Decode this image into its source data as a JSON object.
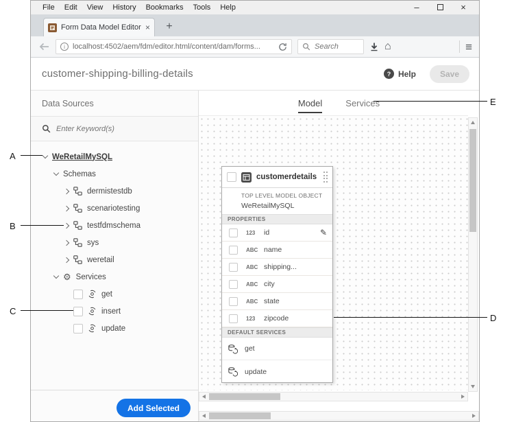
{
  "chrome": {
    "menu": [
      "File",
      "Edit",
      "View",
      "History",
      "Bookmarks",
      "Tools",
      "Help"
    ],
    "window_controls": {
      "minimize": "–",
      "close": "×"
    },
    "tab": {
      "title": "Form Data Model Editor",
      "close": "×",
      "new_tab": "+"
    },
    "urlbar": {
      "url": "localhost:4502/aem/fdm/editor.html/content/dam/forms...",
      "search_placeholder": "Search"
    }
  },
  "header": {
    "title": "customer-shipping-billing-details",
    "help": "Help",
    "save": "Save"
  },
  "sidebar": {
    "title": "Data Sources",
    "search_placeholder": "Enter Keyword(s)",
    "root_node": "WeRetailMySQL",
    "schemas_label": "Schemas",
    "schemas": [
      "dermistestdb",
      "scenariotesting",
      "testfdmschema",
      "sys",
      "weretail"
    ],
    "services_label": "Services",
    "service_items": [
      "get",
      "insert",
      "update"
    ],
    "add_selected": "Add Selected"
  },
  "workspace": {
    "tabs": {
      "model": "Model",
      "services": "Services"
    },
    "card": {
      "title": "customerdetails",
      "type_label": "TOP LEVEL MODEL OBJECT",
      "source_label": "WeRetailMySQL",
      "properties_header": "PROPERTIES",
      "properties": [
        {
          "dtype": "123",
          "name": "id"
        },
        {
          "dtype": "ABC",
          "name": "name"
        },
        {
          "dtype": "ABC",
          "name": "shipping..."
        },
        {
          "dtype": "ABC",
          "name": "city"
        },
        {
          "dtype": "ABC",
          "name": "state"
        },
        {
          "dtype": "123",
          "name": "zipcode"
        }
      ],
      "services_header": "DEFAULT SERVICES",
      "services": [
        "get",
        "update"
      ]
    }
  },
  "annotations": {
    "a": "A",
    "b": "B",
    "c": "C",
    "d": "D",
    "e": "E"
  },
  "glyphs": {
    "hamburger": "≡",
    "home": "⌂",
    "gear": "⚙",
    "pencil": "✎",
    "help_q": "?",
    "info": "i"
  },
  "colors": {
    "accent_blue": "#1473e6"
  }
}
